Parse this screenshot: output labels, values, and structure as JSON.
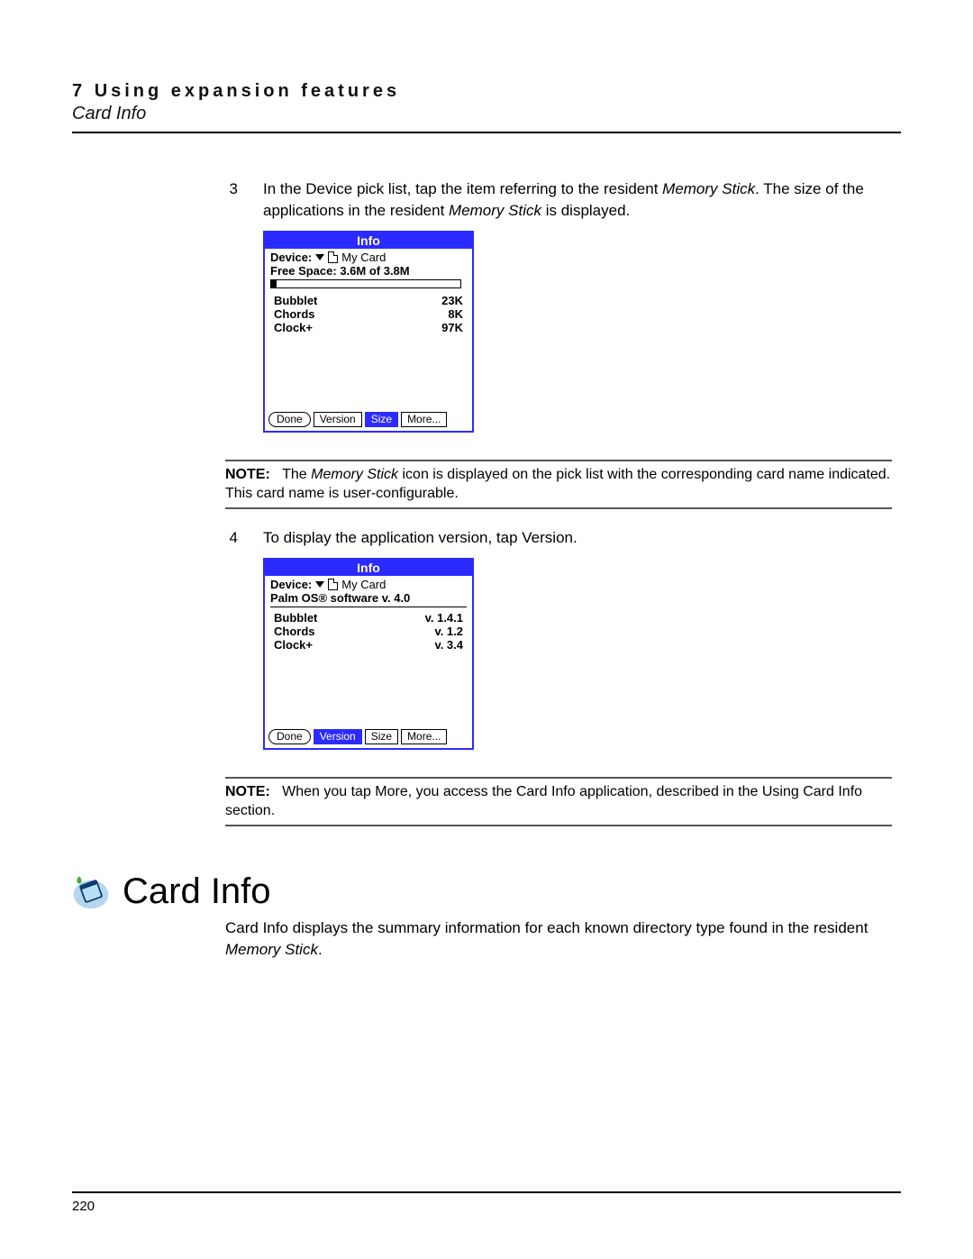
{
  "header": {
    "chapter_num": "7",
    "chapter_title": "Using expansion features",
    "section": "Card Info"
  },
  "steps": {
    "s3": {
      "num": "3",
      "text_a": "In the Device pick list, tap the item referring to the resident ",
      "mem1": "Memory Stick",
      "text_b": ". The size of the applications in the resident ",
      "mem2": "Memory Stick",
      "text_c": " is displayed."
    },
    "s4": {
      "num": "4",
      "text": "To display the application version, tap Version."
    }
  },
  "palm1": {
    "title": "Info",
    "device_label": "Device:",
    "device_value": "My Card",
    "free_space": "Free Space: 3.6M of 3.8M",
    "items": [
      {
        "name": "Bubblet",
        "val": "23K"
      },
      {
        "name": "Chords",
        "val": "8K"
      },
      {
        "name": "Clock+",
        "val": "97K"
      }
    ],
    "done": "Done",
    "version": "Version",
    "size": "Size",
    "more": "More..."
  },
  "palm2": {
    "title": "Info",
    "device_label": "Device:",
    "device_value": "My Card",
    "os_line": "Palm OS® software v. 4.0",
    "items": [
      {
        "name": "Bubblet",
        "val": "v. 1.4.1"
      },
      {
        "name": "Chords",
        "val": "v. 1.2"
      },
      {
        "name": "Clock+",
        "val": "v. 3.4"
      }
    ],
    "done": "Done",
    "version": "Version",
    "size": "Size",
    "more": "More..."
  },
  "note1": {
    "label": "NOTE:",
    "a": "The ",
    "mem": "Memory Stick",
    "b": " icon is displayed on the pick list with the corresponding card name indicated. This card name is user-configurable."
  },
  "note2": {
    "label": "NOTE:",
    "text": "When you tap More, you access the Card Info application, described in the Using Card Info section."
  },
  "section2": {
    "heading": "Card Info",
    "para_a": "Card Info displays the summary information for each known directory type found in the resident ",
    "mem": "Memory Stick",
    "para_b": "."
  },
  "footer": {
    "page": "220"
  }
}
